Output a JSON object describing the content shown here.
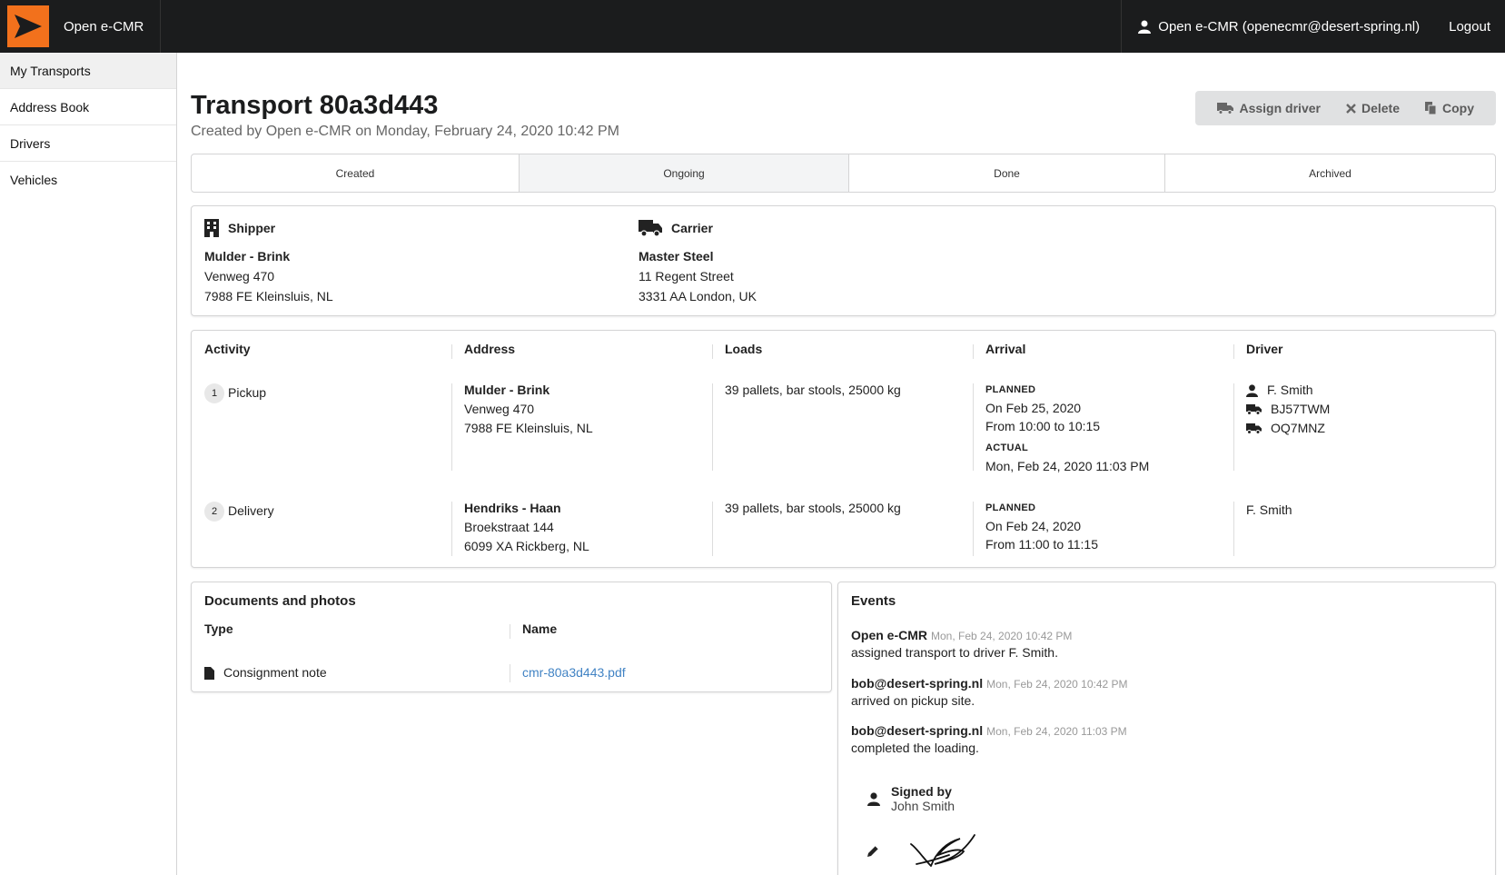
{
  "app": {
    "brand": "Open e-CMR",
    "user": "Open e-CMR (openecmr@desert-spring.nl)",
    "logout": "Logout"
  },
  "sidebar": {
    "items": [
      {
        "label": "My Transports"
      },
      {
        "label": "Address Book"
      },
      {
        "label": "Drivers"
      },
      {
        "label": "Vehicles"
      }
    ]
  },
  "transport": {
    "title": "Transport 80a3d443",
    "subtitle": "Created by Open e-CMR on Monday, February 24, 2020 10:42 PM"
  },
  "actions": {
    "assign_driver": "Assign driver",
    "delete": "Delete",
    "copy": "Copy"
  },
  "steps": [
    {
      "label": "Created"
    },
    {
      "label": "Ongoing"
    },
    {
      "label": "Done"
    },
    {
      "label": "Archived"
    }
  ],
  "shipper": {
    "heading": "Shipper",
    "name": "Mulder - Brink",
    "street": "Venweg 470",
    "city": "7988 FE Kleinsluis, NL"
  },
  "carrier": {
    "heading": "Carrier",
    "name": "Master Steel",
    "street": "11 Regent Street",
    "city": "3331 AA London, UK"
  },
  "activities": {
    "headers": {
      "activity": "Activity",
      "address": "Address",
      "loads": "Loads",
      "arrival": "Arrival",
      "driver": "Driver"
    },
    "rows": [
      {
        "num": "1",
        "activity": "Pickup",
        "addr_name": "Mulder - Brink",
        "addr_street": "Venweg 470",
        "addr_city": "7988 FE Kleinsluis, NL",
        "loads": "39 pallets, bar stools, 25000 kg",
        "planned_label": "PLANNED",
        "planned_date": "On Feb 25, 2020",
        "planned_time": "From 10:00 to 10:15",
        "actual_label": "ACTUAL",
        "actual_value": "Mon, Feb 24, 2020 11:03 PM",
        "driver": "F. Smith",
        "vehicle1": "BJ57TWM",
        "vehicle2": "OQ7MNZ"
      },
      {
        "num": "2",
        "activity": "Delivery",
        "addr_name": "Hendriks - Haan",
        "addr_street": "Broekstraat 144",
        "addr_city": "6099 XA Rickberg, NL",
        "loads": "39 pallets, bar stools, 25000 kg",
        "planned_label": "PLANNED",
        "planned_date": "On Feb 24, 2020",
        "planned_time": "From 11:00 to 11:15",
        "driver": "F. Smith"
      }
    ]
  },
  "documents": {
    "heading": "Documents and photos",
    "col_type": "Type",
    "col_name": "Name",
    "rows": [
      {
        "type": "Consignment note",
        "name": "cmr-80a3d443.pdf"
      }
    ]
  },
  "events": {
    "heading": "Events",
    "items": [
      {
        "who": "Open e-CMR",
        "when": "Mon, Feb 24, 2020 10:42 PM",
        "what": "assigned transport to driver F. Smith."
      },
      {
        "who": "bob@desert-spring.nl",
        "when": "Mon, Feb 24, 2020 10:42 PM",
        "what": "arrived on pickup site."
      },
      {
        "who": "bob@desert-spring.nl",
        "when": "Mon, Feb 24, 2020 11:03 PM",
        "what": "completed the loading."
      }
    ],
    "signed_label": "Signed by",
    "signed_name": "John Smith"
  },
  "colors": {
    "brand_orange": "#f2711c",
    "topbar": "#1b1c1d",
    "link": "#4183c4"
  }
}
